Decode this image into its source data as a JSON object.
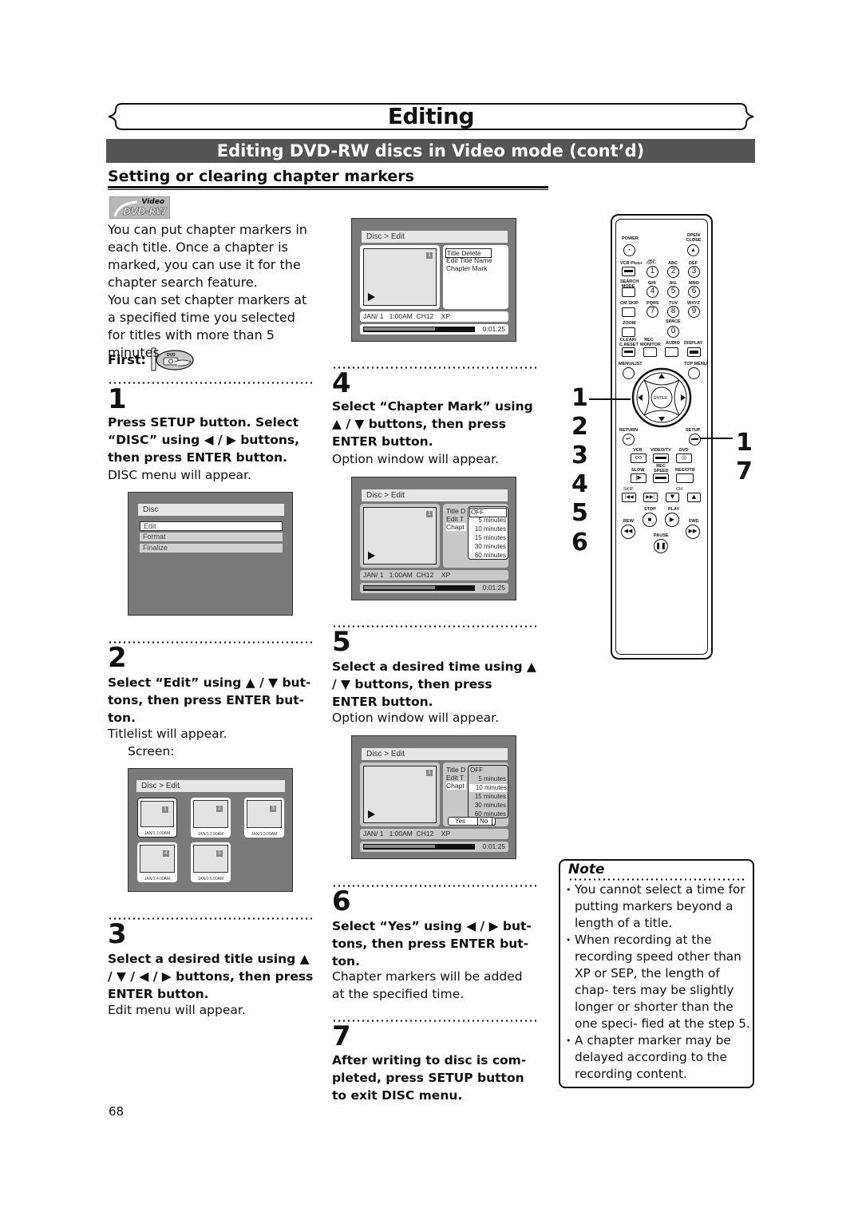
{
  "header": {
    "title": "Editing",
    "subtitle": "Editing DVD-RW discs in Video mode (cont’d)",
    "section": "Setting or clearing chapter markers"
  },
  "badge": {
    "top": "Video",
    "bottom": "DVD-RW"
  },
  "intro": {
    "paragraphs": [
      "You can put chapter markers in each title. Once a chapter is marked, you can use it for the chapter search feature.",
      "You can set chapter markers at a specified time you selected for titles with more than 5 minutes."
    ],
    "first_label": "First:",
    "first_icon_label": "DVD"
  },
  "steps": [
    {
      "num": "1",
      "instruction": "Press SETUP button. Select “DISC” using ◀ / ▶ buttons, then press ENTER button.",
      "result": "DISC menu will appear."
    },
    {
      "num": "2",
      "instruction": "Select “Edit” using ▲ / ▼ but- tons, then press ENTER but- ton.",
      "result": "Titlelist will appear.",
      "extra": "Screen:"
    },
    {
      "num": "3",
      "instruction": "Select a desired title using ▲ / ▼ / ◀ / ▶ buttons, then press ENTER button.",
      "result": "Edit menu will appear."
    },
    {
      "num": "4",
      "instruction": "Select “Chapter Mark” using ▲ / ▼ buttons, then press ENTER button.",
      "result": "Option window will appear."
    },
    {
      "num": "5",
      "instruction": "Select a desired time using ▲ / ▼ buttons, then press ENTER button.",
      "result": "Option window will appear."
    },
    {
      "num": "6",
      "instruction": "Select “Yes” using ◀ / ▶ but- tons, then press ENTER but- ton.",
      "result": "Chapter markers will be added at the specified time."
    },
    {
      "num": "7",
      "instruction": "After writing to disc is com- pleted, press SETUP button to exit DISC menu.",
      "result": ""
    }
  ],
  "disc_menu": {
    "header": "Disc",
    "items": [
      "Edit",
      "Format",
      "Finalize"
    ],
    "selected": "Edit"
  },
  "titlelist": {
    "header": "Disc > Edit",
    "titles": [
      {
        "num": "1",
        "caption": "JAN/1   1:00AM"
      },
      {
        "num": "2",
        "caption": "JAN/1   2:00AM"
      },
      {
        "num": "3",
        "caption": "JAN/1   3:00AM"
      },
      {
        "num": "4",
        "caption": "JAN/1   4:00AM"
      },
      {
        "num": "5",
        "caption": "JAN/1   5:00AM"
      }
    ],
    "selected": "1"
  },
  "edit_screen": {
    "header": "Disc > Edit",
    "title_num": "1",
    "menu": [
      "Title Delete",
      "Edit Title Name",
      "Chapter Mark"
    ],
    "menu_truncated": [
      "Title D",
      "Edit T",
      "Chapt"
    ],
    "info": "JAN/ 1   1:00AM  CH12    XP",
    "elapsed": "0:01:25",
    "progress_fraction": 0.65,
    "options": [
      "OFF",
      "5 minutes",
      "10 minutes",
      "15 minutes",
      "30 minutes",
      "60 minutes"
    ],
    "confirm": {
      "yes": "Yes",
      "no": "No"
    }
  },
  "remote": {
    "labels": {
      "power": "POWER",
      "open_close": "OPEN/ CLOSE",
      "vcr_plus": "VCR Plus+",
      "k1": ".@/:",
      "k2": "ABC",
      "k3": "DEF",
      "search_mode": "SEARCH MODE",
      "k4": "GHI",
      "k5": "JKL",
      "k6": "MNO",
      "cm_skip": "CM SKIP",
      "k7": "PQRS",
      "k8": "TUV",
      "k9": "WXYZ",
      "zoom": "ZOOM",
      "k0": "SPACE",
      "clear": "CLEAR/ C.RESET",
      "rec_monitor": "REC MONITOR",
      "audio": "AUDIO",
      "display": "DISPLAY",
      "menu_list": "MENU/LIST",
      "top_menu": "TOP MENU",
      "enter": "ENTER",
      "return": "RETURN",
      "setup": "SETUP",
      "vcr": "VCR",
      "video_tv": "VIDEO/TV",
      "dvd": "DVD",
      "slow": "SLOW",
      "rec_speed": "REC SPEED",
      "rec_otr": "REC/OTR",
      "skip": "SKIP",
      "ch": "CH",
      "stop": "STOP",
      "play": "PLAY",
      "rew": "REW",
      "fwd": "FWD",
      "pause": "PAUSE"
    },
    "digits": [
      "1",
      "2",
      "3",
      "4",
      "5",
      "6",
      "7",
      "8",
      "9",
      "0"
    ],
    "callouts_left": [
      "1",
      "2",
      "3",
      "4",
      "5",
      "6"
    ],
    "callouts_right": [
      "1",
      "7"
    ]
  },
  "note": {
    "title": "Note",
    "items": [
      "You cannot select a time for putting markers beyond a length of a title.",
      "When recording at the recording speed other than XP or SEP, the length of chap- ters may be slightly longer or shorter than the one speci- fied at the step 5.",
      "A chapter marker may be delayed according to the recording content."
    ]
  },
  "page_number": "68"
}
